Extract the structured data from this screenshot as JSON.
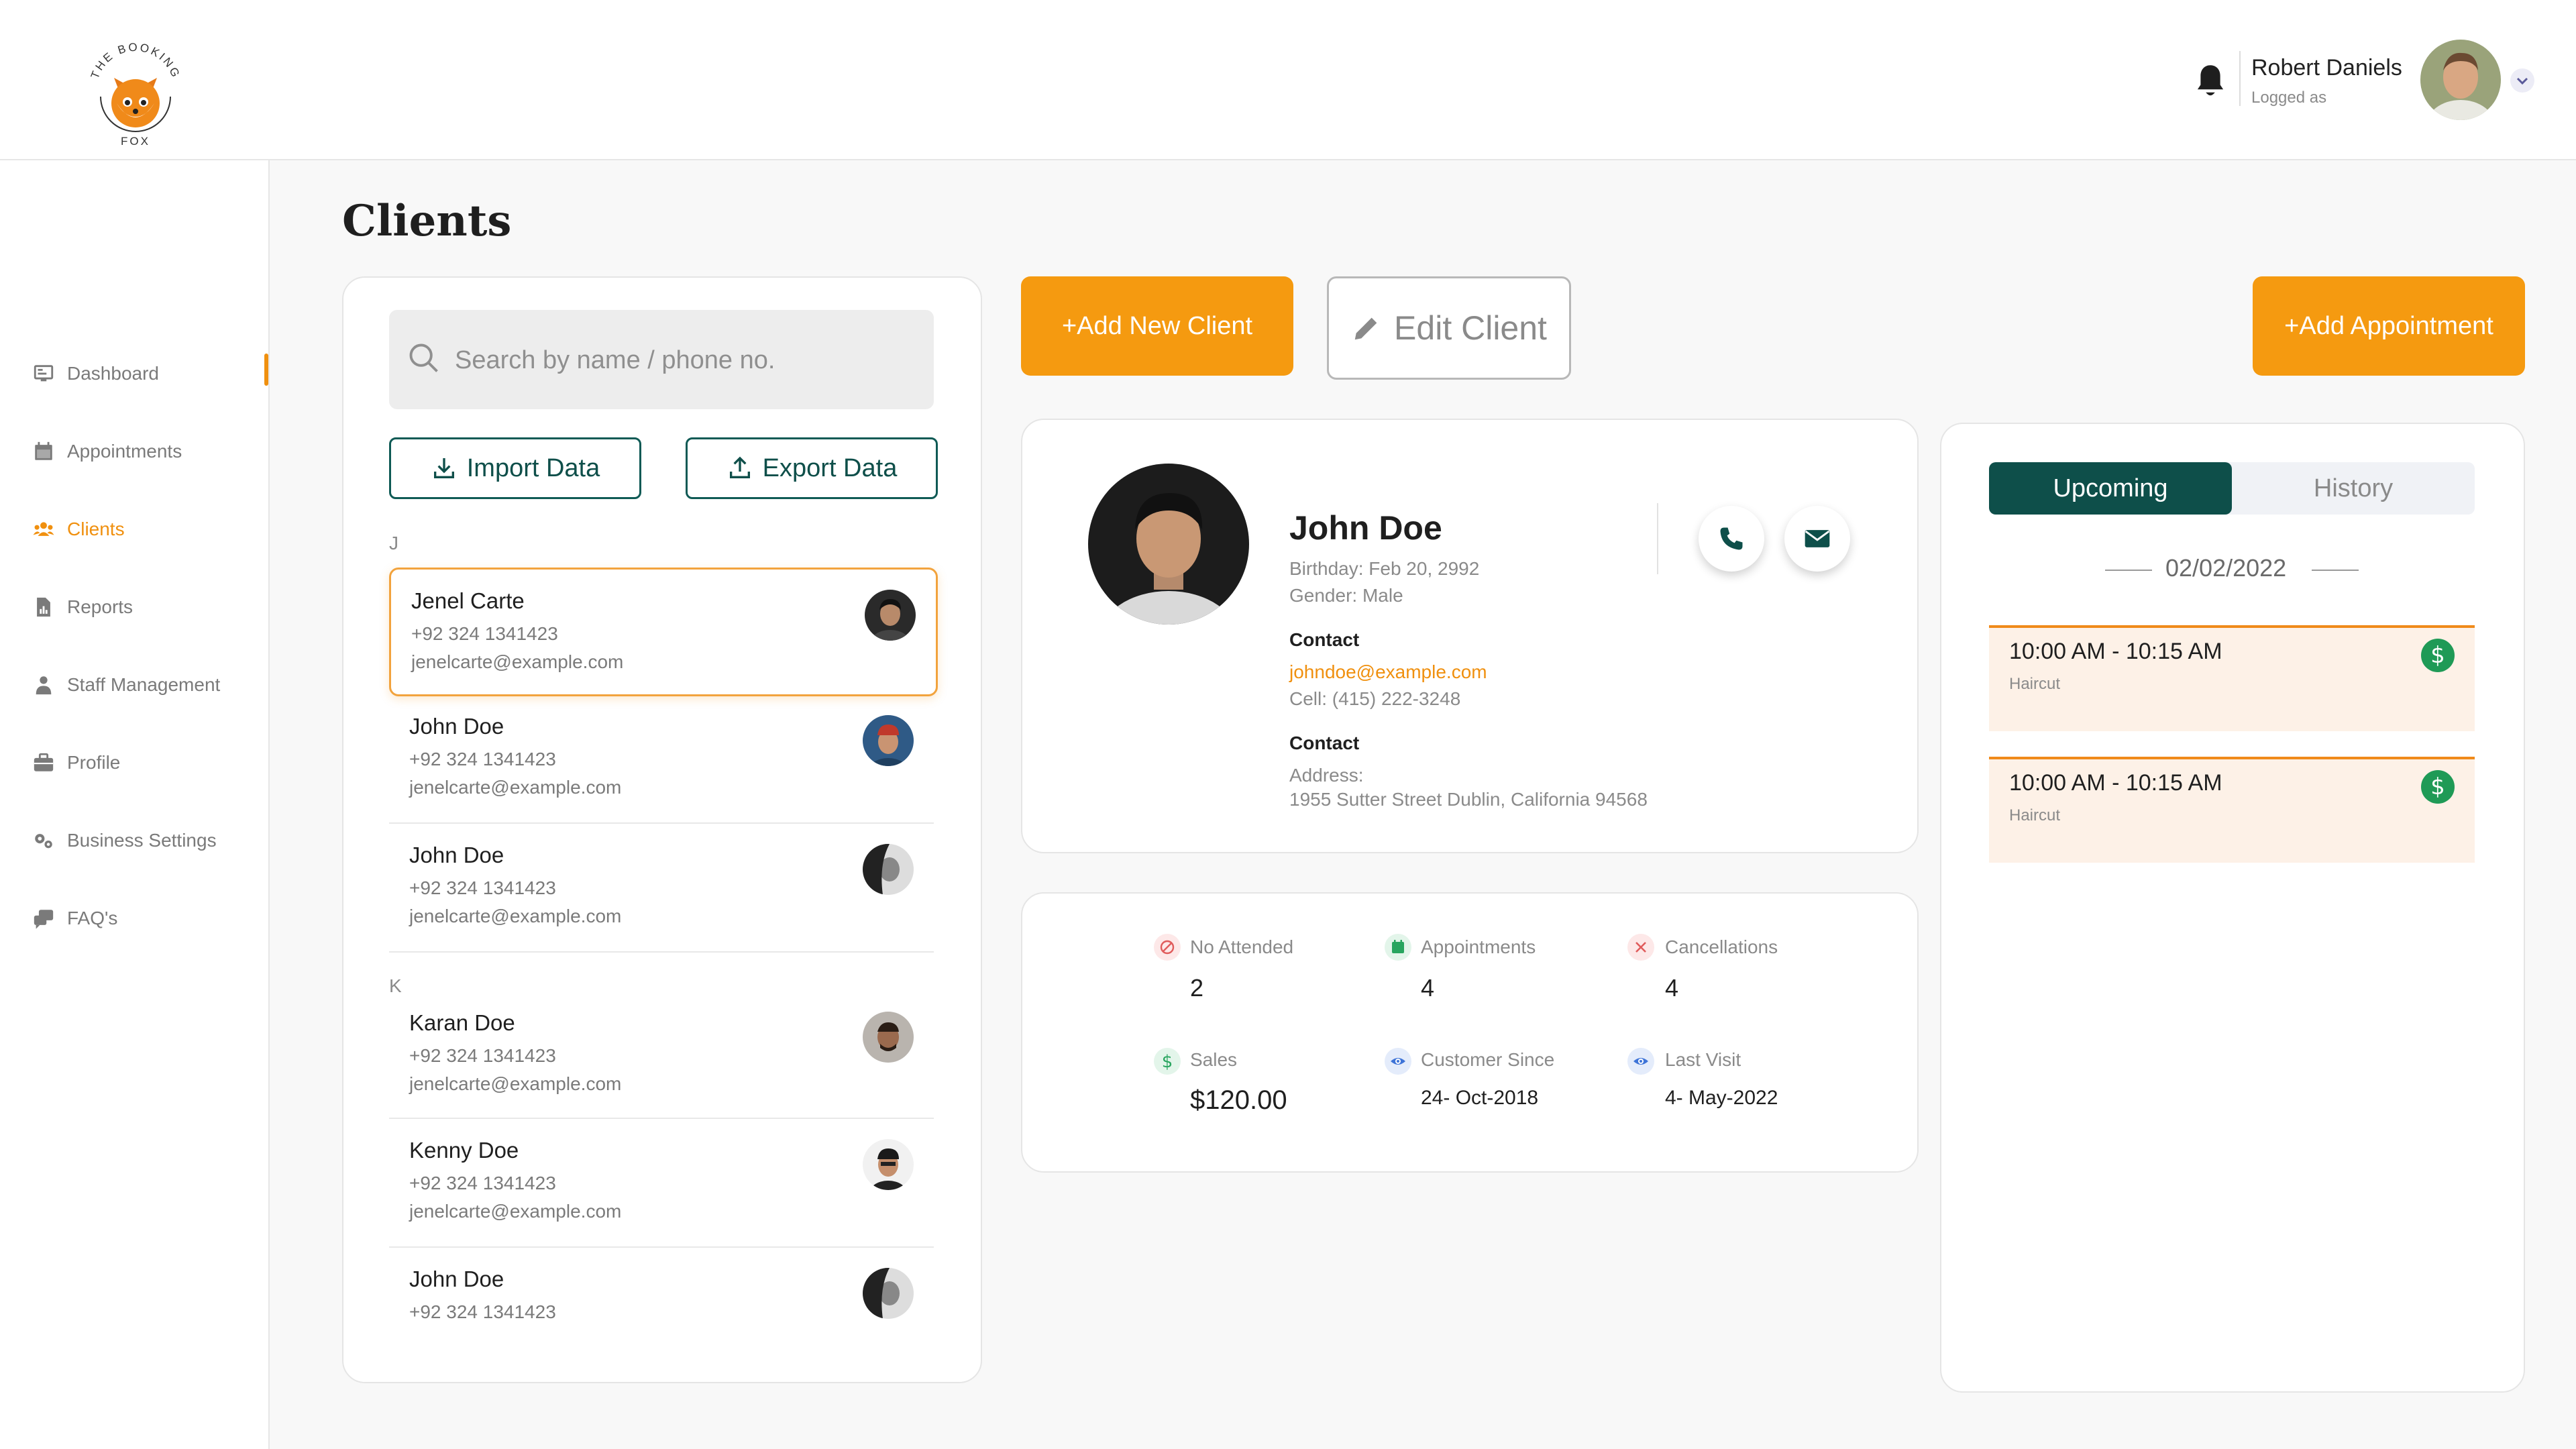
{
  "brand": {
    "logo_top": "THE BOOKING",
    "logo_bottom": "FOX"
  },
  "user": {
    "name": "Robert Daniels",
    "subtitle": "Logged as"
  },
  "sidebar": {
    "items": [
      {
        "label": "Dashboard",
        "icon": "monitor-icon"
      },
      {
        "label": "Appointments",
        "icon": "calendar-icon"
      },
      {
        "label": "Clients",
        "icon": "users-icon",
        "active": true
      },
      {
        "label": "Reports",
        "icon": "report-icon"
      },
      {
        "label": "Staff Management",
        "icon": "person-icon"
      },
      {
        "label": "Profile",
        "icon": "briefcase-icon"
      },
      {
        "label": "Business Settings",
        "icon": "gears-icon"
      },
      {
        "label": "FAQ's",
        "icon": "faq-icon"
      }
    ]
  },
  "page": {
    "title": "Clients"
  },
  "client_list": {
    "search_placeholder": "Search by name / phone no.",
    "import_label": "Import Data",
    "export_label": "Export Data",
    "groups": [
      {
        "letter": "J",
        "clients": [
          {
            "name": "Jenel Carte",
            "phone": "+92 324 1341423",
            "email": "jenelcarte@example.com",
            "selected": true
          },
          {
            "name": "John Doe",
            "phone": "+92 324 1341423",
            "email": "jenelcarte@example.com"
          },
          {
            "name": "John Doe",
            "phone": "+92 324 1341423",
            "email": "jenelcarte@example.com"
          }
        ]
      },
      {
        "letter": "K",
        "clients": [
          {
            "name": "Karan Doe",
            "phone": "+92 324 1341423",
            "email": "jenelcarte@example.com"
          },
          {
            "name": "Kenny Doe",
            "phone": "+92 324 1341423",
            "email": "jenelcarte@example.com"
          },
          {
            "name": "John Doe",
            "phone": "+92 324 1341423"
          }
        ]
      }
    ]
  },
  "actions": {
    "add_client": "+Add New Client",
    "edit_client": "Edit Client",
    "add_appointment": "+Add Appointment"
  },
  "profile": {
    "name": "John Doe",
    "birthday": "Birthday: Feb 20, 2992",
    "gender": "Gender: Male",
    "contact_label": "Contact",
    "email": "johndoe@example.com",
    "cell": "Cell: (415) 222-3248",
    "contact_label_2": "Contact",
    "address_label": "Address:",
    "address": "1955 Sutter Street Dublin, California 94568"
  },
  "stats": {
    "no_attended": {
      "label": "No Attended",
      "value": "2"
    },
    "appointments": {
      "label": "Appointments",
      "value": "4"
    },
    "cancellations": {
      "label": "Cancellations",
      "value": "4"
    },
    "sales": {
      "label": "Sales",
      "value": "$120.00"
    },
    "customer_since": {
      "label": "Customer Since",
      "value": "24- Oct-2018"
    },
    "last_visit": {
      "label": "Last Visit",
      "value": "4- May-2022"
    }
  },
  "appointments_panel": {
    "tabs": [
      {
        "label": "Upcoming",
        "active": true
      },
      {
        "label": "History"
      }
    ],
    "date": "02/02/2022",
    "items": [
      {
        "time": "10:00 AM - 10:15 AM",
        "service": "Haircut",
        "badge": "$"
      },
      {
        "time": "10:00 AM - 10:15 AM",
        "service": "Haircut",
        "badge": "$"
      }
    ]
  },
  "colors": {
    "accent": "#f59a10",
    "primary_dark": "#0e4f4a",
    "paid_green": "#1f9a56"
  }
}
